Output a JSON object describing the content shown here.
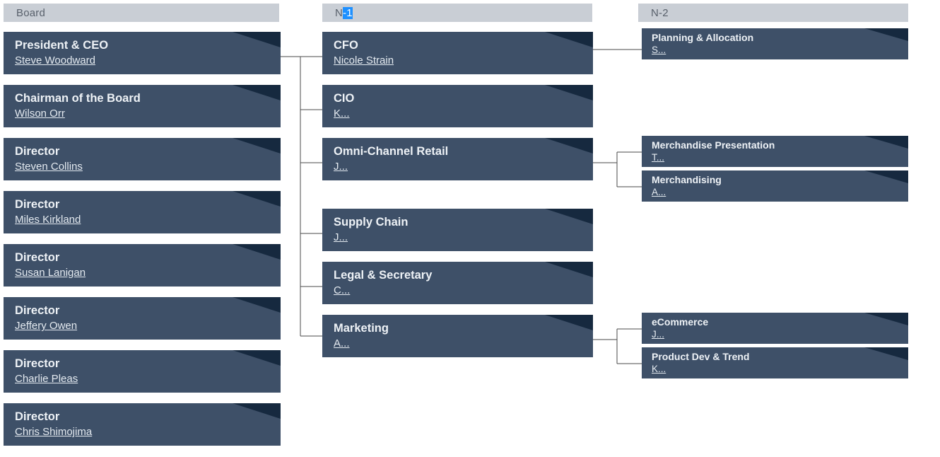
{
  "columns": [
    {
      "id": "board",
      "label": "Board",
      "selected_suffix": ""
    },
    {
      "id": "n1",
      "label": "N",
      "selected_suffix": "-1"
    },
    {
      "id": "n2",
      "label": "N-2",
      "selected_suffix": ""
    }
  ],
  "board": {
    "header": "Board",
    "nodes": [
      {
        "title": "President & CEO",
        "person": "Steve Woodward"
      },
      {
        "title": "Chairman of the Board",
        "person": "Wilson Orr"
      },
      {
        "title": "Director",
        "person": "Steven Collins"
      },
      {
        "title": "Director",
        "person": "Miles Kirkland"
      },
      {
        "title": "Director",
        "person": "Susan Lanigan"
      },
      {
        "title": "Director",
        "person": "Jeffery Owen"
      },
      {
        "title": "Director",
        "person": "Charlie Pleas"
      },
      {
        "title": "Director",
        "person": "Chris Shimojima"
      }
    ]
  },
  "n1": {
    "header_prefix": "N",
    "header_selected": "-1",
    "nodes": [
      {
        "title": "CFO",
        "person": "Nicole Strain"
      },
      {
        "title": "CIO",
        "person": "K..."
      },
      {
        "title": "Omni-Channel Retail",
        "person": "J..."
      },
      {
        "title": "Supply Chain",
        "person": "J..."
      },
      {
        "title": "Legal & Secretary",
        "person": "C..."
      },
      {
        "title": "Marketing",
        "person": "A..."
      }
    ]
  },
  "n2": {
    "header": "N-2",
    "nodes": [
      {
        "title": "Planning & Allocation",
        "person": "S..."
      },
      {
        "title": "Merchandise Presentation",
        "person": "T..."
      },
      {
        "title": "Merchandising",
        "person": "A..."
      },
      {
        "title": "eCommerce",
        "person": "J..."
      },
      {
        "title": "Product Dev & Trend",
        "person": "K..."
      }
    ]
  },
  "colors": {
    "card_body": "#3e5068",
    "card_fold": "#16293f",
    "header_bar": "#c9ced5",
    "header_text": "#58606b",
    "selection": "#1e90ff",
    "connector": "#4a4a4a",
    "page_background": "#ffffff"
  }
}
